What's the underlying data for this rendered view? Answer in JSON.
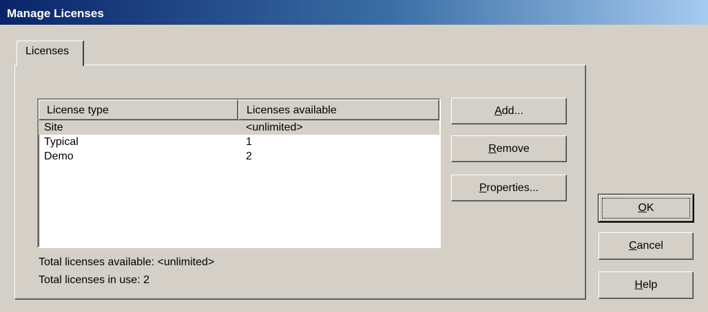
{
  "window": {
    "title": "Manage Licenses"
  },
  "tabs": [
    {
      "label": "Licenses"
    }
  ],
  "list": {
    "columns": [
      "License type",
      "Licenses available"
    ],
    "rows": [
      {
        "type": "Site",
        "available": "<unlimited>"
      },
      {
        "type": "Typical",
        "available": "1"
      },
      {
        "type": "Demo",
        "available": "2"
      }
    ],
    "selected_index": 0
  },
  "totals": {
    "available_text": "Total licenses available: <unlimited>",
    "in_use_text": "Total licenses in use:  2"
  },
  "buttons": {
    "add": {
      "mnemonic": "A",
      "rest": "dd..."
    },
    "remove": {
      "mnemonic": "R",
      "rest": "emove"
    },
    "properties": {
      "mnemonic": "P",
      "rest": "roperties..."
    },
    "ok": {
      "mnemonic": "O",
      "rest": "K"
    },
    "cancel": {
      "mnemonic": "C",
      "rest": "ancel"
    },
    "help": {
      "mnemonic": "H",
      "rest": "elp"
    }
  }
}
